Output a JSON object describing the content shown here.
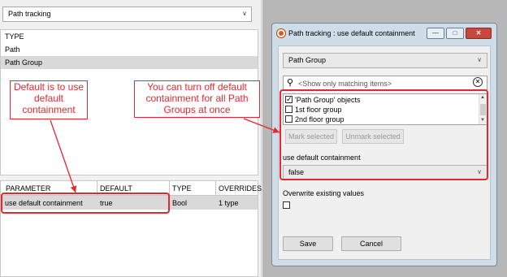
{
  "left_panel": {
    "combo_value": "Path tracking",
    "types": {
      "header": "TYPE",
      "rows": [
        "Path",
        "Path Group"
      ]
    },
    "params": {
      "columns": [
        "PARAMETER",
        "DEFAULT",
        "TYPE",
        "OVERRIDES"
      ],
      "row": [
        "use default containment",
        "true",
        "Bool",
        "1 type"
      ]
    }
  },
  "dialog": {
    "title": "Path tracking : use default containment",
    "group_combo": "Path Group",
    "search_placeholder": "<Show only matching items>",
    "items": [
      "'Path Group' objects",
      "1st floor group",
      "2nd floor group"
    ],
    "mark_selected": "Mark selected",
    "unmark_selected": "Unmark selected",
    "udc_label": "use default containment",
    "udc_value": "false",
    "overwrite_label": "Overwrite existing values",
    "save": "Save",
    "cancel": "Cancel"
  },
  "annotations": {
    "left_note": "Default is to use default containment",
    "right_note": "You can turn off default containment for all Path Groups at once",
    "color": "#e8262d"
  }
}
